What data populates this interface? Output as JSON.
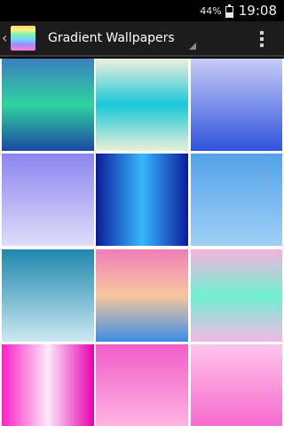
{
  "status_bar": {
    "battery_percent": "44%",
    "battery_level": 0.44,
    "time": "19:08"
  },
  "action_bar": {
    "title": "Gradient Wallpapers",
    "up_caret": "‹",
    "app_icon": "rainbow-gradient-icon",
    "overflow_icon": "overflow-menu-icon",
    "background": "#1c1c1c"
  },
  "wallpapers": [
    {
      "name": "teal-green-navy",
      "colors": [
        "#3b7fbd",
        "#2fd3a0",
        "#1a47a0"
      ]
    },
    {
      "name": "aqua-stripes",
      "colors": [
        "#f1f0dd",
        "#19c7d8",
        "#e9f0d9"
      ]
    },
    {
      "name": "periwinkle-blue",
      "colors": [
        "#c7ccf7",
        "#2f54dd"
      ]
    },
    {
      "name": "lavender-fade",
      "colors": [
        "#8b86ef",
        "#e0dcfb"
      ]
    },
    {
      "name": "royal-blue-glow",
      "colors": [
        "#0a1b9a",
        "#38b8ff",
        "#0a1b9a"
      ]
    },
    {
      "name": "sky-blue",
      "colors": [
        "#53a2ea",
        "#9fd0f7"
      ]
    },
    {
      "name": "ocean-teal",
      "colors": [
        "#1e86ad",
        "#cde8f2"
      ]
    },
    {
      "name": "peach-sky",
      "colors": [
        "#f07fb9",
        "#f7c79e",
        "#3a8de6"
      ]
    },
    {
      "name": "pastel-mint-pink",
      "colors": [
        "#f6b2dc",
        "#6ff0d0",
        "#f4b8e6"
      ]
    },
    {
      "name": "magenta-glow",
      "colors": [
        "#ff1fc6",
        "#fde8f8",
        "#e800b0"
      ]
    },
    {
      "name": "hot-pink-fade",
      "colors": [
        "#f25cc9",
        "#ffb3e2"
      ]
    },
    {
      "name": "soft-pink",
      "colors": [
        "#ffc4ea",
        "#f76bd0"
      ]
    }
  ]
}
